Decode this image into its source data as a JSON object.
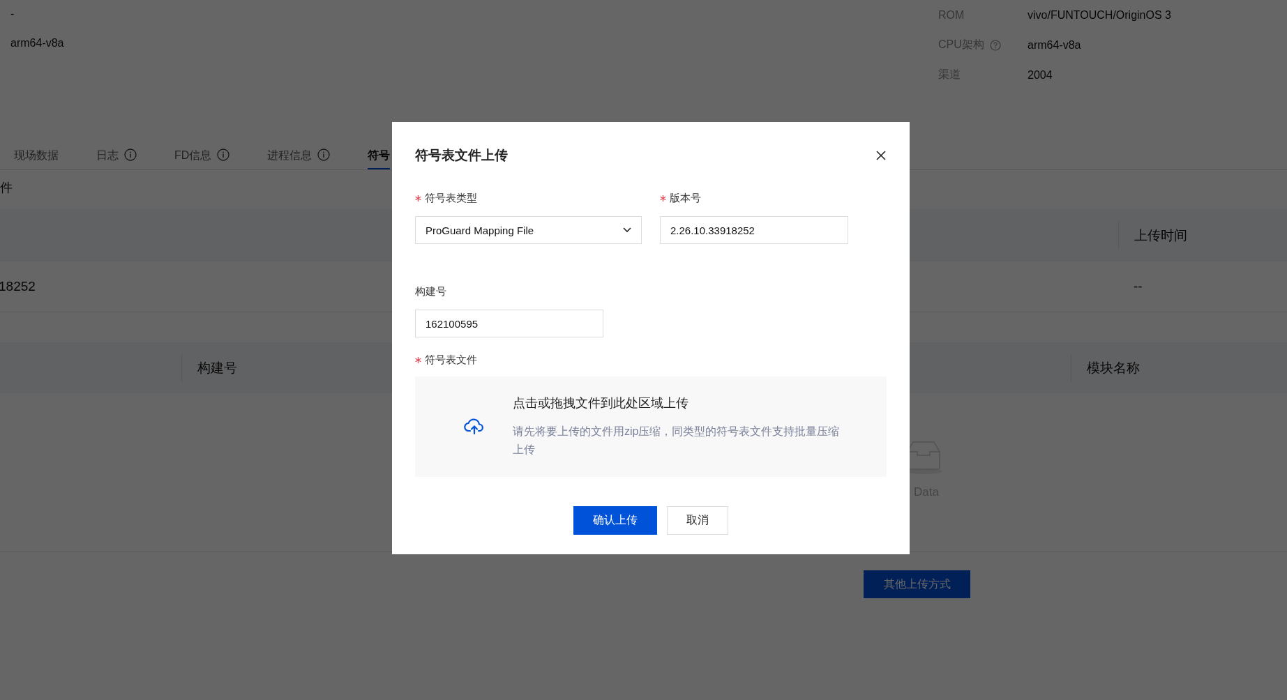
{
  "device_info_left": [
    {
      "value": "-"
    },
    {
      "value": "arm64-v8a"
    }
  ],
  "device_info_right": [
    {
      "label": "ROM",
      "value": "vivo/FUNTOUCH/OriginOS 3",
      "help": false
    },
    {
      "label": "CPU架构",
      "value": "arm64-v8a",
      "help": true
    },
    {
      "label": "渠道",
      "value": "2004",
      "help": false
    }
  ],
  "tabs": [
    {
      "label": "现场数据",
      "info": false,
      "selected": false
    },
    {
      "label": "日志",
      "info": true,
      "selected": false
    },
    {
      "label": "FD信息",
      "info": true,
      "selected": false
    },
    {
      "label": "进程信息",
      "info": true,
      "selected": false
    },
    {
      "label": "符号",
      "info": false,
      "selected": true
    }
  ],
  "section_title": "件",
  "version_table": {
    "columns": [
      "",
      "上传时间"
    ],
    "rows": [
      {
        "cells": [
          "18252",
          "--"
        ]
      }
    ]
  },
  "module_table": {
    "columns": [
      "构建号",
      "模块名称"
    ],
    "empty_text": "Data"
  },
  "other_upload_button": "其他上传方式",
  "dialog": {
    "title": "符号表文件上传",
    "fields": [
      {
        "kind": "select",
        "label": "符号表类型",
        "required": true,
        "value": "ProGuard Mapping File"
      },
      {
        "kind": "input",
        "label": "版本号",
        "required": true,
        "value": "2.26.10.33918252"
      },
      {
        "kind": "input",
        "label": "构建号",
        "required": false,
        "value": "162100595"
      }
    ],
    "upload": {
      "label": "符号表文件",
      "required": true,
      "title": "点击或拖拽文件到此处区域上传",
      "hint": "请先将要上传的文件用zip压缩，同类型的符号表文件支持批量压缩上传"
    },
    "buttons": [
      {
        "label": "确认上传",
        "primary": true
      },
      {
        "label": "取消",
        "primary": false
      }
    ]
  }
}
